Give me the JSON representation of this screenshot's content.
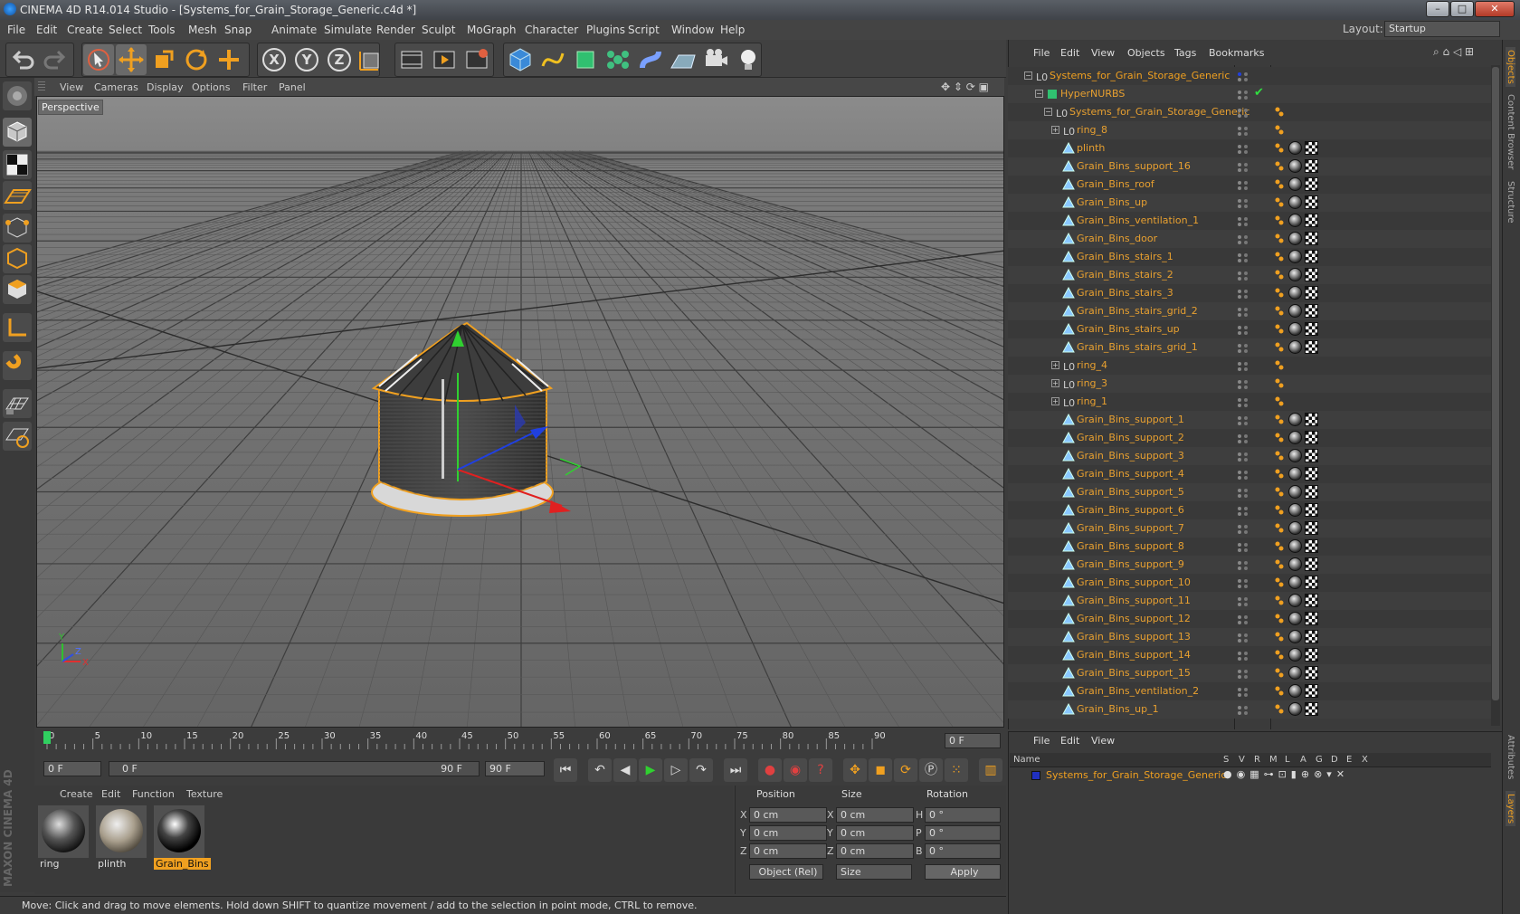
{
  "window": {
    "title": "CINEMA 4D R14.014 Studio - [Systems_for_Grain_Storage_Generic.c4d *]",
    "min_label": "–",
    "max_label": "□",
    "close_label": "✕"
  },
  "menu": [
    "File",
    "Edit",
    "Create",
    "Select",
    "Tools",
    "Mesh",
    "Snap",
    "Animate",
    "Simulate",
    "Render",
    "Sculpt",
    "MoGraph",
    "Character",
    "Plugins",
    "Script",
    "Window",
    "Help"
  ],
  "layout": {
    "label": "Layout:",
    "value": "Startup"
  },
  "toolbar": {
    "x_label": "X",
    "y_label": "Y",
    "z_label": "Z"
  },
  "viewport": {
    "menu": [
      "View",
      "Cameras",
      "Display",
      "Options",
      "Filter",
      "Panel"
    ],
    "label": "Perspective",
    "axis_y": "Y",
    "axis_x": "X",
    "axis_z": "Z"
  },
  "timeline": {
    "ticks": [
      "0",
      "5",
      "10",
      "15",
      "20",
      "25",
      "30",
      "35",
      "40",
      "45",
      "50",
      "55",
      "60",
      "65",
      "70",
      "75",
      "80",
      "85",
      "90"
    ],
    "current_frame": "0 F",
    "start_field": "0 F",
    "range_start": "0 F",
    "range_end": "90 F",
    "end_field": "90 F"
  },
  "materials": {
    "menu": [
      "Create",
      "Edit",
      "Function",
      "Texture"
    ],
    "items": [
      {
        "name": "ring"
      },
      {
        "name": "plinth"
      },
      {
        "name": "Grain_Bins"
      }
    ]
  },
  "coords": {
    "headers": [
      "Position",
      "Size",
      "Rotation"
    ],
    "rows": [
      {
        "axis": "X",
        "pos": "0 cm",
        "size_axis": "X",
        "size": "0 cm",
        "rot_axis": "H",
        "rot": "0 °"
      },
      {
        "axis": "Y",
        "pos": "0 cm",
        "size_axis": "Y",
        "size": "0 cm",
        "rot_axis": "P",
        "rot": "0 °"
      },
      {
        "axis": "Z",
        "pos": "0 cm",
        "size_axis": "Z",
        "size": "0 cm",
        "rot_axis": "B",
        "rot": "0 °"
      }
    ],
    "mode": "Object (Rel)",
    "size_mode": "Size",
    "apply": "Apply"
  },
  "status": "Move: Click and drag to move elements. Hold down SHIFT to quantize movement / add to the selection in point mode, CTRL to remove.",
  "maxon": "MAXON CINEMA 4D",
  "objects": {
    "menu": [
      "File",
      "Edit",
      "View",
      "Objects",
      "Tags",
      "Bookmarks"
    ],
    "rows": [
      {
        "name": "Systems_for_Grain_Storage_Generic",
        "indent": 0,
        "kind": "null",
        "exp": "−"
      },
      {
        "name": "HyperNURBS",
        "indent": 1,
        "kind": "nurbs",
        "exp": "−"
      },
      {
        "name": "Systems_for_Grain_Storage_Generic",
        "indent": 2,
        "kind": "null",
        "exp": "−"
      },
      {
        "name": "ring_8",
        "indent": 3,
        "kind": "null",
        "exp": "+"
      },
      {
        "name": "plinth",
        "indent": 3,
        "kind": "poly",
        "exp": ""
      },
      {
        "name": "Grain_Bins_support_16",
        "indent": 3,
        "kind": "poly",
        "exp": ""
      },
      {
        "name": "Grain_Bins_roof",
        "indent": 3,
        "kind": "poly",
        "exp": ""
      },
      {
        "name": "Grain_Bins_up",
        "indent": 3,
        "kind": "poly",
        "exp": ""
      },
      {
        "name": "Grain_Bins_ventilation_1",
        "indent": 3,
        "kind": "poly",
        "exp": ""
      },
      {
        "name": "Grain_Bins_door",
        "indent": 3,
        "kind": "poly",
        "exp": ""
      },
      {
        "name": "Grain_Bins_stairs_1",
        "indent": 3,
        "kind": "poly",
        "exp": ""
      },
      {
        "name": "Grain_Bins_stairs_2",
        "indent": 3,
        "kind": "poly",
        "exp": ""
      },
      {
        "name": "Grain_Bins_stairs_3",
        "indent": 3,
        "kind": "poly",
        "exp": ""
      },
      {
        "name": "Grain_Bins_stairs_grid_2",
        "indent": 3,
        "kind": "poly",
        "exp": ""
      },
      {
        "name": "Grain_Bins_stairs_up",
        "indent": 3,
        "kind": "poly",
        "exp": ""
      },
      {
        "name": "Grain_Bins_stairs_grid_1",
        "indent": 3,
        "kind": "poly",
        "exp": ""
      },
      {
        "name": "ring_4",
        "indent": 3,
        "kind": "null",
        "exp": "+"
      },
      {
        "name": "ring_3",
        "indent": 3,
        "kind": "null",
        "exp": "+"
      },
      {
        "name": "ring_1",
        "indent": 3,
        "kind": "null",
        "exp": "+"
      },
      {
        "name": "Grain_Bins_support_1",
        "indent": 3,
        "kind": "poly",
        "exp": ""
      },
      {
        "name": "Grain_Bins_support_2",
        "indent": 3,
        "kind": "poly",
        "exp": ""
      },
      {
        "name": "Grain_Bins_support_3",
        "indent": 3,
        "kind": "poly",
        "exp": ""
      },
      {
        "name": "Grain_Bins_support_4",
        "indent": 3,
        "kind": "poly",
        "exp": ""
      },
      {
        "name": "Grain_Bins_support_5",
        "indent": 3,
        "kind": "poly",
        "exp": ""
      },
      {
        "name": "Grain_Bins_support_6",
        "indent": 3,
        "kind": "poly",
        "exp": ""
      },
      {
        "name": "Grain_Bins_support_7",
        "indent": 3,
        "kind": "poly",
        "exp": ""
      },
      {
        "name": "Grain_Bins_support_8",
        "indent": 3,
        "kind": "poly",
        "exp": ""
      },
      {
        "name": "Grain_Bins_support_9",
        "indent": 3,
        "kind": "poly",
        "exp": ""
      },
      {
        "name": "Grain_Bins_support_10",
        "indent": 3,
        "kind": "poly",
        "exp": ""
      },
      {
        "name": "Grain_Bins_support_11",
        "indent": 3,
        "kind": "poly",
        "exp": ""
      },
      {
        "name": "Grain_Bins_support_12",
        "indent": 3,
        "kind": "poly",
        "exp": ""
      },
      {
        "name": "Grain_Bins_support_13",
        "indent": 3,
        "kind": "poly",
        "exp": ""
      },
      {
        "name": "Grain_Bins_support_14",
        "indent": 3,
        "kind": "poly",
        "exp": ""
      },
      {
        "name": "Grain_Bins_support_15",
        "indent": 3,
        "kind": "poly",
        "exp": ""
      },
      {
        "name": "Grain_Bins_ventilation_2",
        "indent": 3,
        "kind": "poly",
        "exp": ""
      },
      {
        "name": "Grain_Bins_up_1",
        "indent": 3,
        "kind": "poly",
        "exp": ""
      }
    ]
  },
  "layers": {
    "menu": [
      "File",
      "Edit",
      "View"
    ],
    "columns": [
      "Name",
      "S",
      "V",
      "R",
      "M",
      "L",
      "A",
      "G",
      "D",
      "E",
      "X"
    ],
    "rows": [
      {
        "name": "Systems_for_Grain_Storage_Generic"
      }
    ]
  },
  "side_tabs": [
    "Objects",
    "Content Browser",
    "Structure",
    "Attributes",
    "Layers"
  ],
  "colors": {
    "accent": "#f0a020",
    "object_text": "#e8a030",
    "bg": "#3c3c3c"
  }
}
